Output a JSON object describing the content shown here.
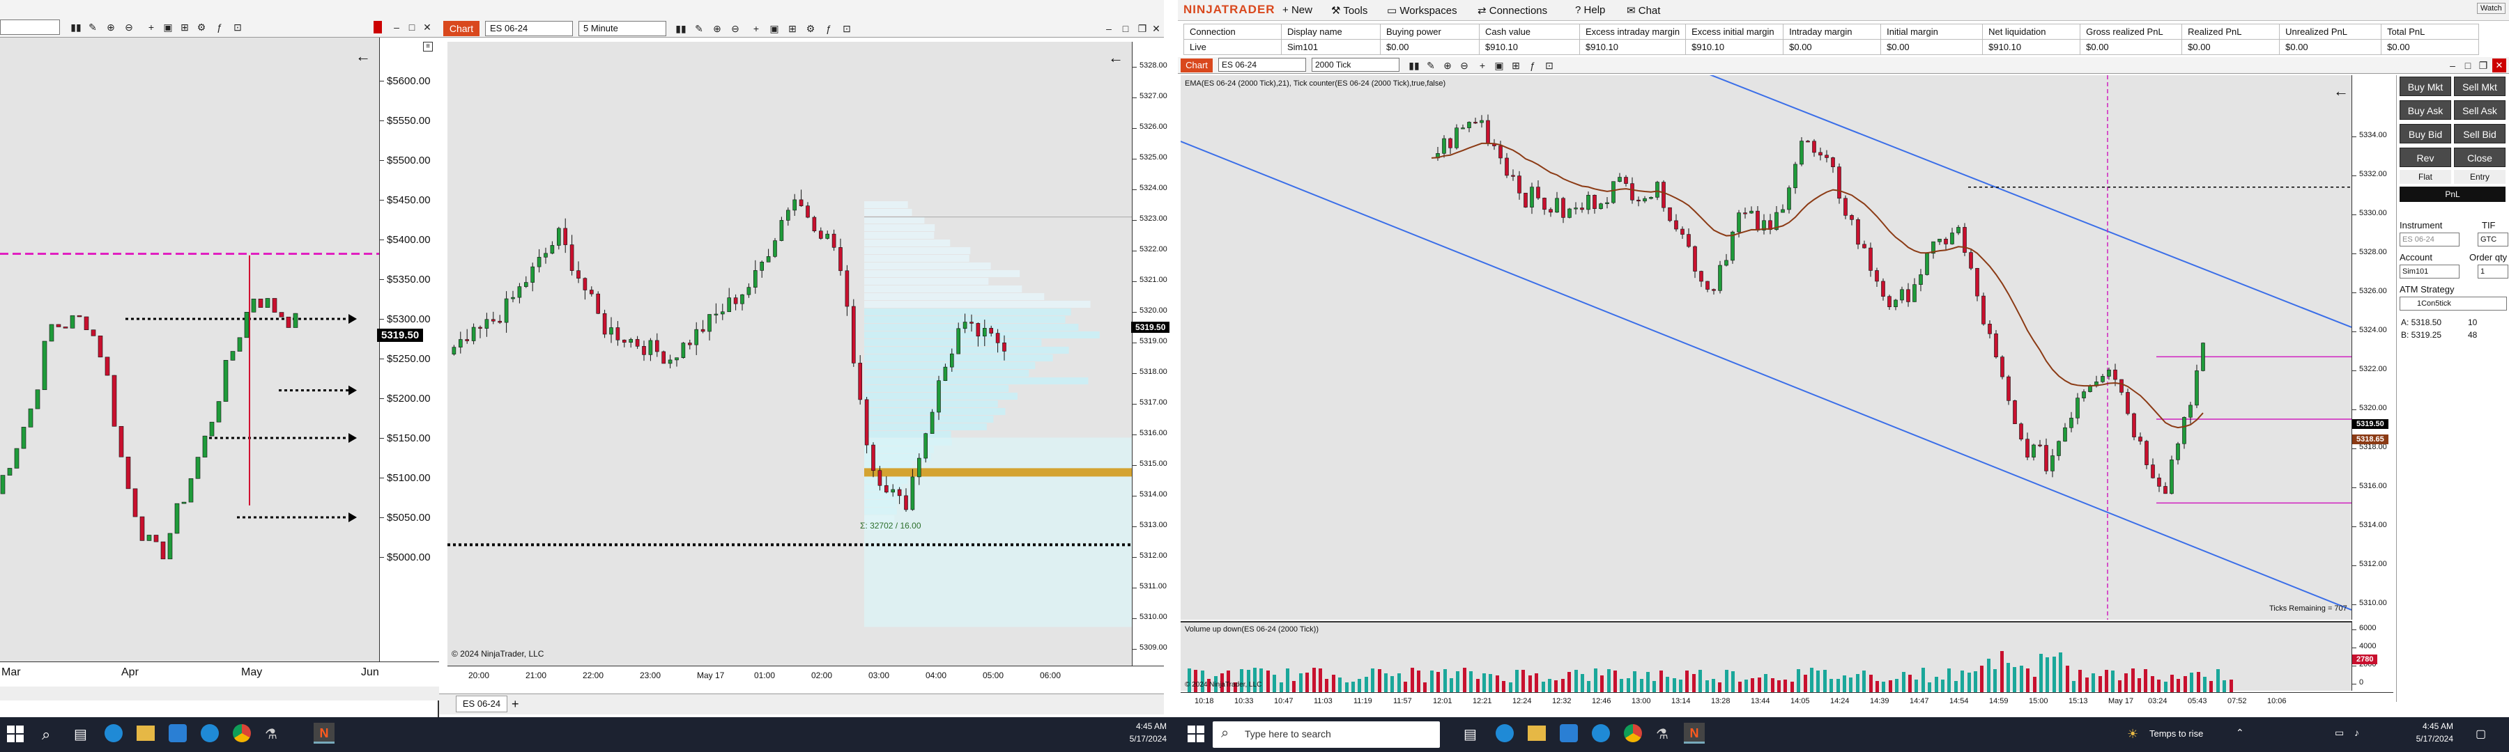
{
  "left_chart": {
    "prices": [
      "$5600.00",
      "$5550.00",
      "$5500.00",
      "$5450.00",
      "$5400.00",
      "$5350.00",
      "$5300.00",
      "$5250.00",
      "$5200.00",
      "$5150.00",
      "$5100.00",
      "$5050.00",
      "$5000.00"
    ],
    "current_price": "5319.50",
    "dates": [
      "Mar",
      "Apr",
      "May",
      "Jun"
    ]
  },
  "mid_chart": {
    "tab_label": "Chart",
    "instrument": "ES 06-24",
    "interval": "5 Minute",
    "prices": [
      "5328.00",
      "5327.00",
      "5326.00",
      "5325.00",
      "5324.00",
      "5323.00",
      "5322.00",
      "5321.00",
      "5320.00",
      "5319.00",
      "5318.00",
      "5317.00",
      "5316.00",
      "5315.00",
      "5314.00",
      "5313.00",
      "5312.00",
      "5311.00",
      "5310.00",
      "5309.00"
    ],
    "current_price": "5319.50",
    "times": [
      "20:00",
      "21:00",
      "22:00",
      "23:00",
      "May 17",
      "01:00",
      "02:00",
      "03:00",
      "04:00",
      "05:00",
      "06:00"
    ],
    "profile_label": "Σ: 32702 / 16.00",
    "copyright": "© 2024 NinjaTrader, LLC",
    "bottom_tab": "ES 06-24"
  },
  "main": {
    "brand": "NINJATRADER",
    "menu": [
      "New",
      "Tools",
      "Workspaces",
      "Connections",
      "Help",
      "Chat"
    ],
    "watch_label": "Watch",
    "account_headers": [
      "Connection",
      "Display name",
      "Buying power",
      "Cash value",
      "Excess intraday margin",
      "Excess initial margin",
      "Intraday margin",
      "Initial margin",
      "Net liquidation",
      "Gross realized PnL",
      "Realized PnL",
      "Unrealized PnL",
      "Total PnL"
    ],
    "account_row": [
      "Live",
      "Sim101",
      "$0.00",
      "$910.10",
      "$910.10",
      "$910.10",
      "$0.00",
      "$0.00",
      "$910.10",
      "$0.00",
      "$0.00",
      "$0.00",
      "$0.00"
    ],
    "chart_tab": "Chart",
    "instrument": "ES 06-24",
    "interval": "2000 Tick",
    "indicator_label": "EMA(ES 06-24 (2000 Tick),21), Tick counter(ES 06-24 (2000 Tick),true,false)",
    "prices": [
      "5334.00",
      "5332.00",
      "5330.00",
      "5328.00",
      "5326.00",
      "5324.00",
      "5322.00",
      "5320.00",
      "5318.00",
      "5316.00",
      "5314.00",
      "5312.00",
      "5310.00"
    ],
    "current_price": "5319.50",
    "ema_price": "5318.65",
    "ticks_remaining": "Ticks Remaining = 707",
    "volume_label": "Volume up down(ES 06-24 (2000 Tick))",
    "volume_axis": [
      "6000",
      "4000",
      "2000",
      "0"
    ],
    "volume_value": "2780",
    "copyright": "© 2024 NinjaTrader, LLC",
    "times": [
      "10:18",
      "10:33",
      "10:47",
      "11:03",
      "11:19",
      "11:57",
      "12:01",
      "12:21",
      "12:24",
      "12:32",
      "12:46",
      "13:00",
      "13:14",
      "13:28",
      "13:44",
      "14:05",
      "14:24",
      "14:39",
      "14:47",
      "14:54",
      "14:59",
      "15:00",
      "15:13",
      "May 17",
      "03:24",
      "05:43",
      "07:52",
      "10:06"
    ]
  },
  "order_panel": {
    "buttons": [
      "Buy Mkt",
      "Sell Mkt",
      "Buy Ask",
      "Sell Ask",
      "Buy Bid",
      "Sell Bid",
      "Rev",
      "Close"
    ],
    "flat": "Flat",
    "entry": "Entry",
    "pnl": "PnL",
    "instrument_label": "Instrument",
    "tif_label": "TIF",
    "instrument_value": "ES 06-24",
    "tif_value": "GTC",
    "account_label": "Account",
    "qty_label": "Order qty",
    "account_value": "Sim101",
    "qty_value": "1",
    "atm_label": "ATM Strategy",
    "atm_value": "1Con5tick",
    "ask": "A: 5318.50",
    "ask_size": "10",
    "bid": "B: 5319.25",
    "bid_size": "48"
  },
  "taskbar_left": {
    "time": "4:45 AM",
    "date": "5/17/2024"
  },
  "taskbar_right": {
    "search_placeholder": "Type here to search",
    "weather": "Temps to rise",
    "time": "4:45 AM",
    "date": "5/17/2024"
  }
}
